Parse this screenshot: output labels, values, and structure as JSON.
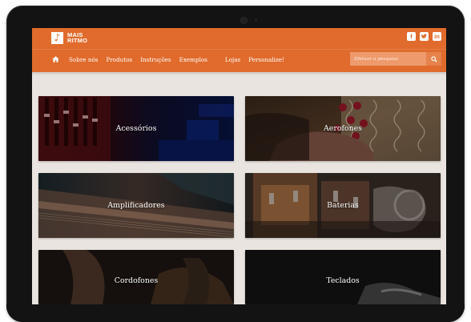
{
  "brand": {
    "name_line1": "MAIS",
    "name_line2": "RITMO",
    "primary_color": "#e06b2c",
    "screen_background": "#e9e4df"
  },
  "social": [
    {
      "name": "facebook-icon",
      "glyph": "f"
    },
    {
      "name": "twitter-icon",
      "glyph": "t"
    },
    {
      "name": "linkedin-icon",
      "glyph": "in"
    }
  ],
  "nav": {
    "home_icon": "home-icon",
    "items": [
      "Sobre nós",
      "Produtos",
      "Instruções",
      "Exemplos",
      "Lojas",
      "Personalize!"
    ]
  },
  "search": {
    "placeholder": "Efetuar a pesquisa",
    "icon": "search-icon"
  },
  "categories": [
    {
      "label": "Acessórios"
    },
    {
      "label": "Aerofones"
    },
    {
      "label": "Amplificadores"
    },
    {
      "label": "Baterias"
    },
    {
      "label": "Cordofones"
    },
    {
      "label": "Teclados"
    }
  ]
}
